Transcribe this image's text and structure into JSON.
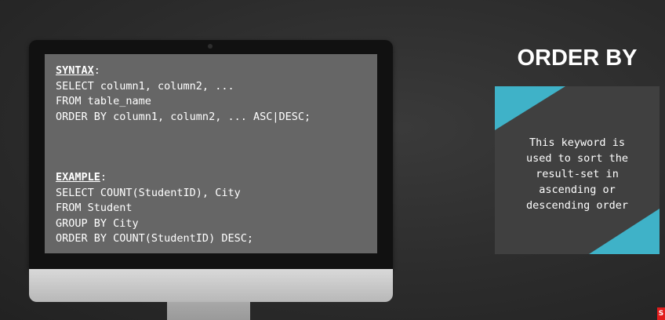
{
  "slide": {
    "title": "ORDER BY",
    "description_lines": [
      "This keyword is",
      "used to sort the",
      "result-set in",
      "ascending or",
      "descending order"
    ],
    "accent_color": "#3fb2c8"
  },
  "screen": {
    "syntax": {
      "heading": "SYNTAX",
      "colon": ":",
      "lines": [
        "SELECT column1, column2, ...",
        "FROM table_name",
        "ORDER BY column1, column2, ... ASC|DESC;"
      ]
    },
    "example": {
      "heading": "EXAMPLE",
      "colon": ":",
      "lines": [
        "SELECT COUNT(StudentID), City",
        "FROM Student",
        "GROUP BY City",
        "ORDER BY COUNT(StudentID) DESC;"
      ]
    }
  },
  "corner_badge": {
    "label": "S",
    "color": "#e21c1c"
  }
}
